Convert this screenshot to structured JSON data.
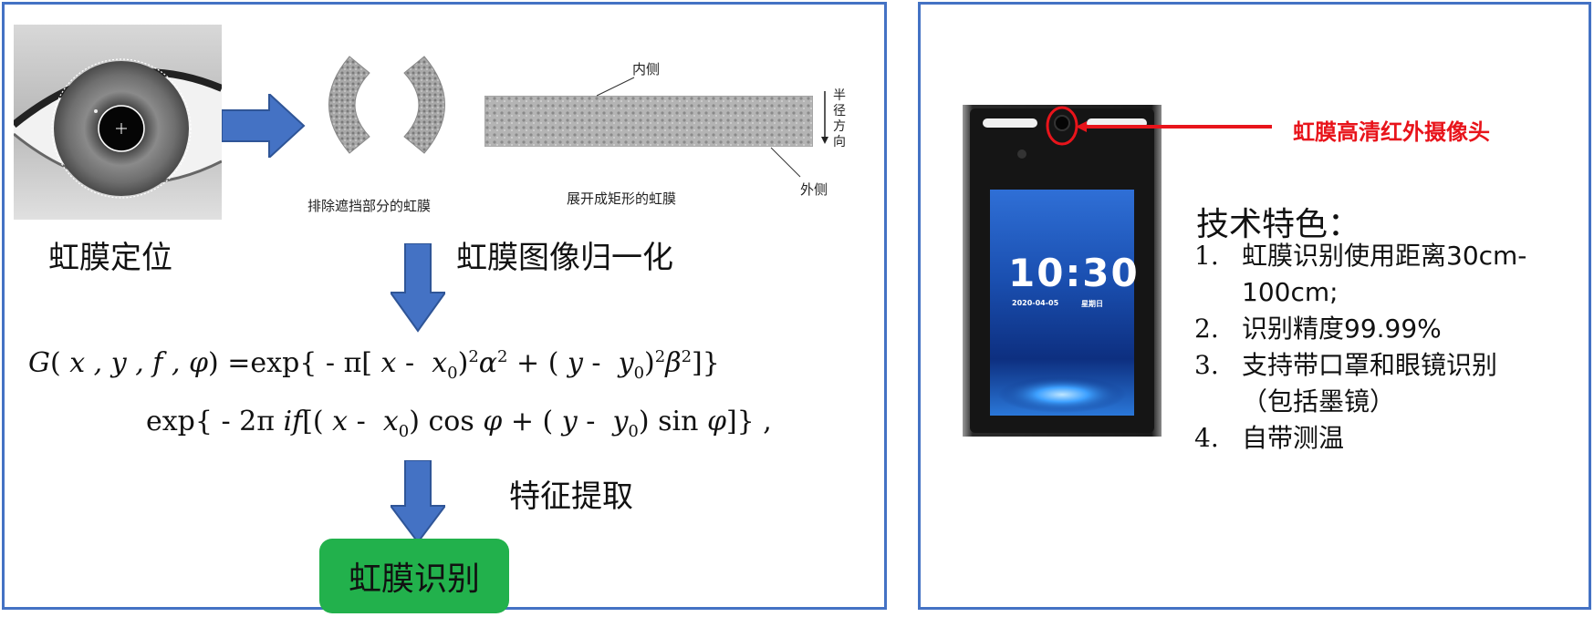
{
  "left": {
    "label_locate": "虹膜定位",
    "label_normalize": "虹膜图像归一化",
    "label_feature": "特征提取",
    "label_recognize": "虹膜识别",
    "small_excluded": "排除遮挡部分的虹膜",
    "small_unfolded": "展开成矩形的虹膜",
    "small_inner": "内侧",
    "small_outer": "外侧",
    "small_radial": "半径方向",
    "colors": {
      "arrow": "#4472c4",
      "box": "#22b14c",
      "border": "#4472c4"
    }
  },
  "right": {
    "camera_label": "虹膜高清红外摄像头",
    "device_time": "10:30",
    "device_date": "2020-04-05",
    "device_weekday": "星期日",
    "features_title": "技术特色：",
    "features": [
      {
        "num": "1.",
        "line1": "虹膜识别使用距离30cm-",
        "line2": "100cm;"
      },
      {
        "num": "2.",
        "line1": "识别精度99.99%",
        "line2": ""
      },
      {
        "num": "3.",
        "line1": "支持带口罩和眼镜识别",
        "line2": "（包括墨镜）"
      },
      {
        "num": "4.",
        "line1": "自带测温",
        "line2": ""
      }
    ],
    "colors": {
      "label": "#e8141b"
    }
  }
}
